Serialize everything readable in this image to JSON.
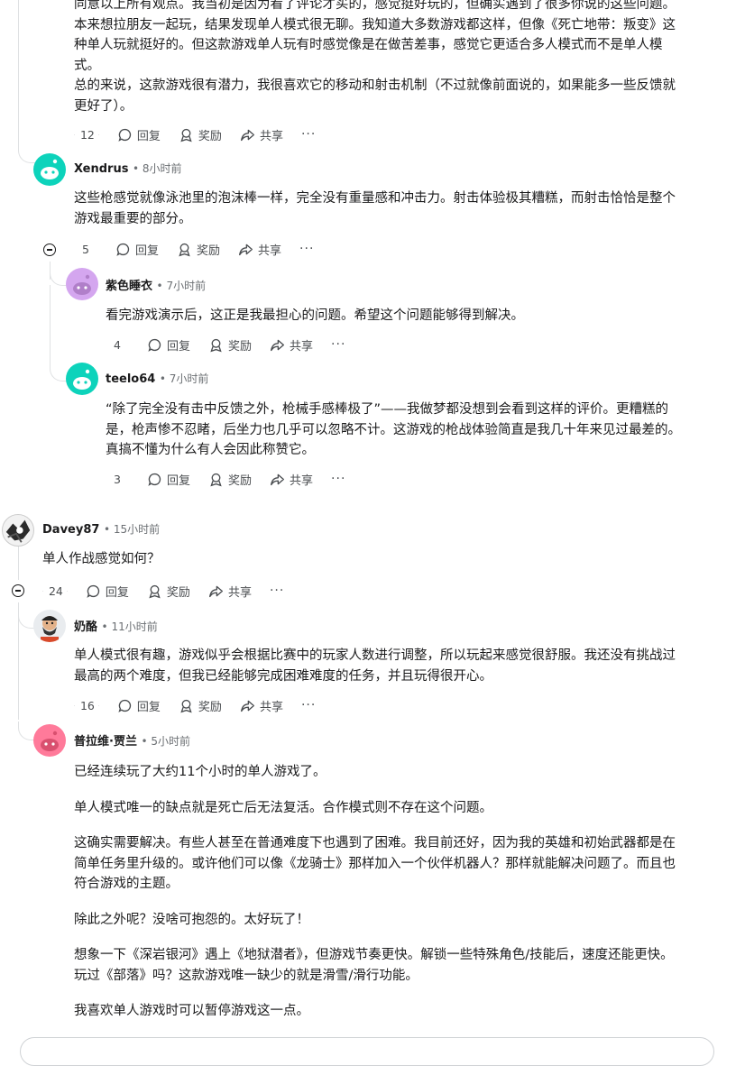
{
  "actions": {
    "reply": "回复",
    "award": "奖励",
    "share": "共享",
    "more": "···"
  },
  "top_comment": {
    "lines": [
      "同意以上所有观点。我当初是因为看了评论才买的，感觉挺好玩的，但确实遇到了很多你说的这些问题。",
      "本来想拉朋友一起玩，结果发现单人模式很无聊。我知道大多数游戏都这样，但像《死亡地带：叛变》这",
      "种单人玩就挺好的。但这款游戏单人玩有时感觉像是在做苦差事，感觉它更适合多人模式而不是单人模",
      "式。",
      "总的来说，这款游戏很有潜力，我很喜欢它的移动和射击机制（不过就像前面说的，如果能多一些反馈就",
      "更好了）。"
    ],
    "votes": "12"
  },
  "xendrus": {
    "author": "Xendrus",
    "time": "• 8小时前",
    "lines": [
      "这些枪感觉就像泳池里的泡沫棒一样，完全没有重量感和冲击力。射击体验极其糟糕，而射击恰恰是整个",
      "游戏最重要的部分。"
    ],
    "votes": "5"
  },
  "purple": {
    "author": "紫色睡衣",
    "time": "• 7小时前",
    "lines": [
      "看完游戏演示后，这正是我最担心的问题。希望这个问题能够得到解决。"
    ],
    "votes": "4"
  },
  "teelo": {
    "author": "teelo64",
    "time": "• 7小时前",
    "lines": [
      "“除了完全没有击中反馈之外，枪械手感棒极了”——我做梦都没想到会看到这样的评价。更糟糕的",
      "是，枪声惨不忍睹，后坐力也几乎可以忽略不计。这游戏的枪战体验简直是我几十年来见过最差的。",
      "真搞不懂为什么有人会因此称赞它。"
    ],
    "votes": "3"
  },
  "davey": {
    "author": "Davey87",
    "time": "• 15小时前",
    "lines": [
      "单人作战感觉如何？"
    ],
    "votes": "24"
  },
  "naiLao": {
    "author": "奶酪",
    "time": "• 11小时前",
    "lines": [
      "单人模式很有趣，游戏似乎会根据比赛中的玩家人数进行调整，所以玩起来感觉很舒服。我还没有挑战过",
      "最高的两个难度，但我已经能够完成困难难度的任务，并且玩得很开心。"
    ],
    "votes": "16"
  },
  "pulawei": {
    "author": "普拉维·贾兰",
    "time": "• 5小时前",
    "paragraphs": [
      [
        "已经连续玩了大约11个小时的单人游戏了。"
      ],
      [
        "单人模式唯一的缺点就是死亡后无法复活。合作模式则不存在这个问题。"
      ],
      [
        "这确实需要解决。有些人甚至在普通难度下也遇到了困难。我目前还好，因为我的英雄和初始武器都是在",
        "简单任务里升级的。或许他们可以像《龙骑士》那样加入一个伙伴机器人？那样就能解决问题了。而且也",
        "符合游戏的主题。"
      ],
      [
        "除此之外呢？没啥可抱怨的。太好玩了！"
      ],
      [
        "想象一下《深岩银河》遇上《地狱潜者》，但游戏节奏更快。解锁一些特殊角色/技能后，速度还能更快。",
        "玩过《部落》吗？这款游戏唯一缺少的就是滑雪/滑行功能。"
      ],
      [
        "我喜欢单人游戏时可以暂停游戏这一点。"
      ]
    ]
  },
  "colors": {
    "teal": "#0dd3bb",
    "purple": "#d4a6ef",
    "pink": "#ff7a9a"
  }
}
